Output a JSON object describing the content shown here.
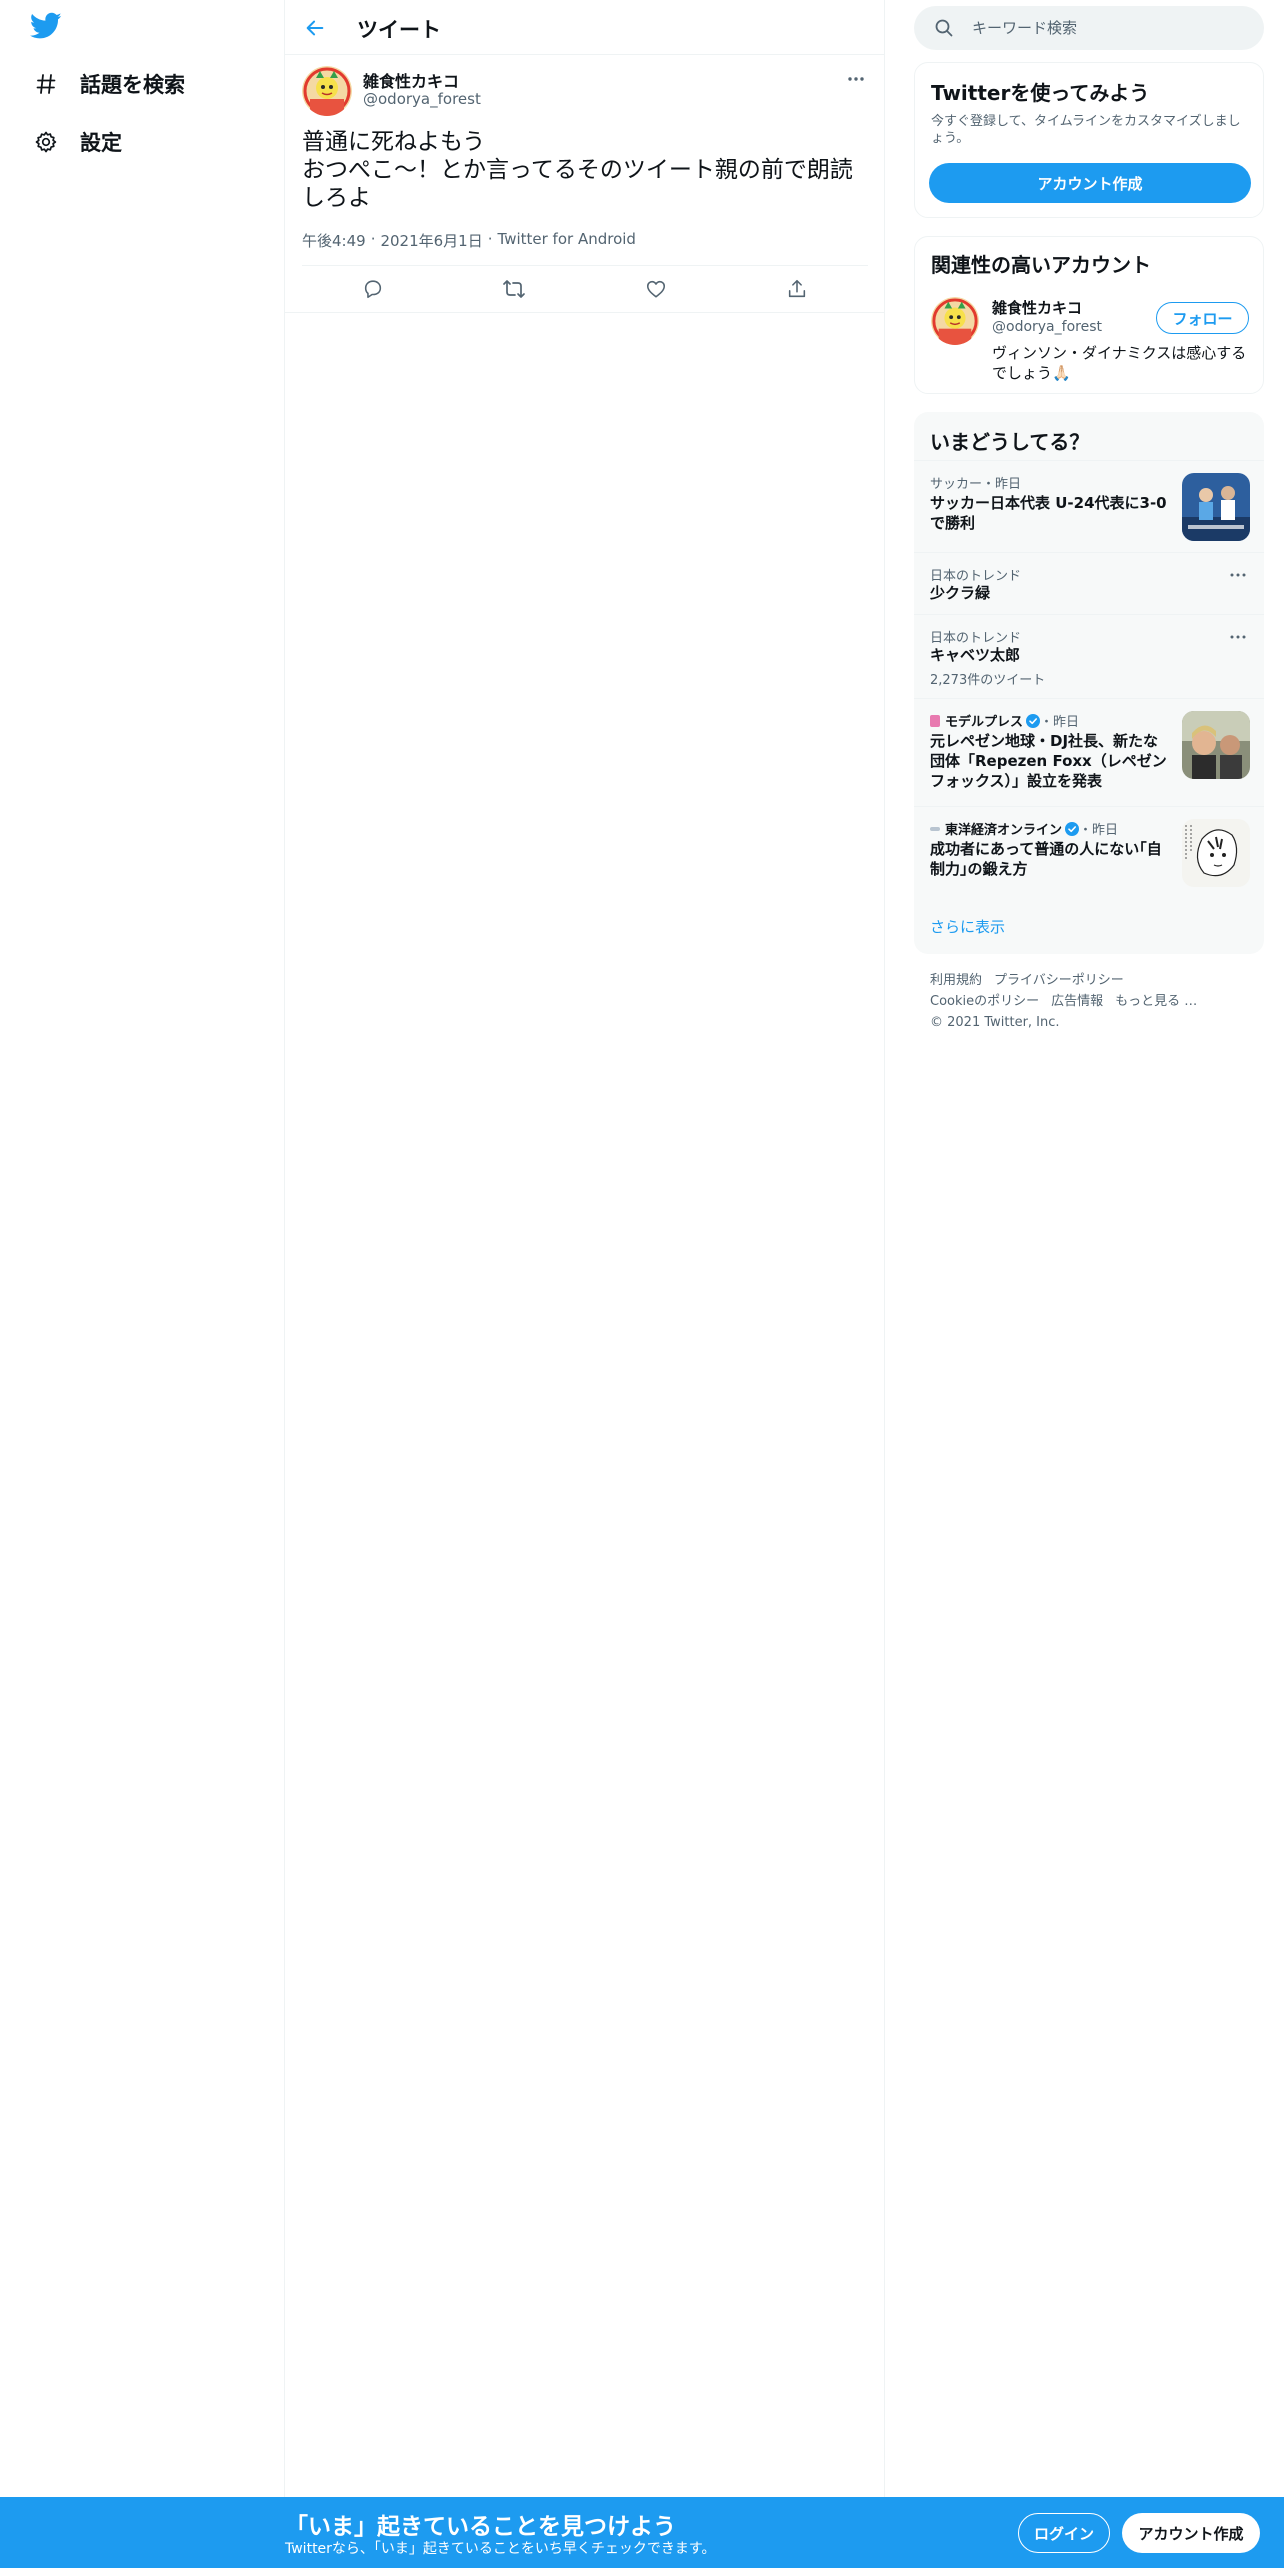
{
  "colors": {
    "accent": "#1d9bf0",
    "text_primary": "#0f1419",
    "text_secondary": "#536471",
    "border": "#eff3f4"
  },
  "nav": {
    "logo_icon": "twitter-bird-icon",
    "items": [
      {
        "label": "話題を検索",
        "icon": "hashtag-icon"
      },
      {
        "label": "設定",
        "icon": "gear-icon"
      }
    ]
  },
  "header": {
    "title": "ツイート",
    "back_icon": "back-arrow-icon"
  },
  "tweet": {
    "author_name": "雑食性カキコ",
    "author_handle": "@odorya_forest",
    "text_lines": [
      "普通に死ねよもう",
      "おつぺこ〜！とか言ってるそのツイート親の前で朗読しろよ"
    ],
    "time": "午後4:49",
    "date": "2021年6月1日",
    "source": "Twitter for Android",
    "separator": "·",
    "actions": [
      "reply-icon",
      "retweet-icon",
      "like-icon",
      "share-icon"
    ]
  },
  "search": {
    "placeholder": "キーワード検索"
  },
  "signup_card": {
    "title": "Twitterを使ってみよう",
    "description": "今すぐ登録して、タイムラインをカスタマイズしましょう。",
    "button": "アカウント作成"
  },
  "related": {
    "title": "関連性の高いアカウント",
    "name": "雑食性カキコ",
    "handle": "@odorya_forest",
    "bio": "ヴィンソン・ダイナミクスは感心するでしょう🙏🏻",
    "follow_button": "フォロー"
  },
  "trends": {
    "title": "いまどうしてる？",
    "items": [
      {
        "meta": "サッカー・昨日",
        "title": "サッカー日本代表 U-24代表に3-0で勝利",
        "has_thumb": true
      },
      {
        "meta": "日本のトレンド",
        "title": "少クラ緑",
        "has_more": true
      },
      {
        "meta": "日本のトレンド",
        "title": "キャベツ太郎",
        "count": "2,273件のツイート",
        "has_more": true
      },
      {
        "source": "モデルプレス",
        "meta_suffix": "・昨日",
        "title": "元レペゼン地球・DJ社長、新たな団体「Repezen Foxx（レペゼンフォックス）」設立を発表",
        "has_thumb": true
      },
      {
        "source": "東洋経済オンライン",
        "meta_suffix": "・昨日",
        "title": "成功者にあって普通の人にない｢自制力｣の鍛え方",
        "has_thumb": true
      }
    ],
    "show_more": "さらに表示"
  },
  "footer": {
    "row1": [
      "利用規約",
      "プライバシーポリシー"
    ],
    "row2": [
      "Cookieのポリシー",
      "広告情報",
      "もっと見る …"
    ],
    "copyright": "© 2021 Twitter, Inc."
  },
  "bottom_bar": {
    "title": "「いま」起きていることを見つけよう",
    "subtitle": "Twitterなら、「いま」起きていることをいち早くチェックできます。",
    "login": "ログイン",
    "signup": "アカウント作成"
  }
}
